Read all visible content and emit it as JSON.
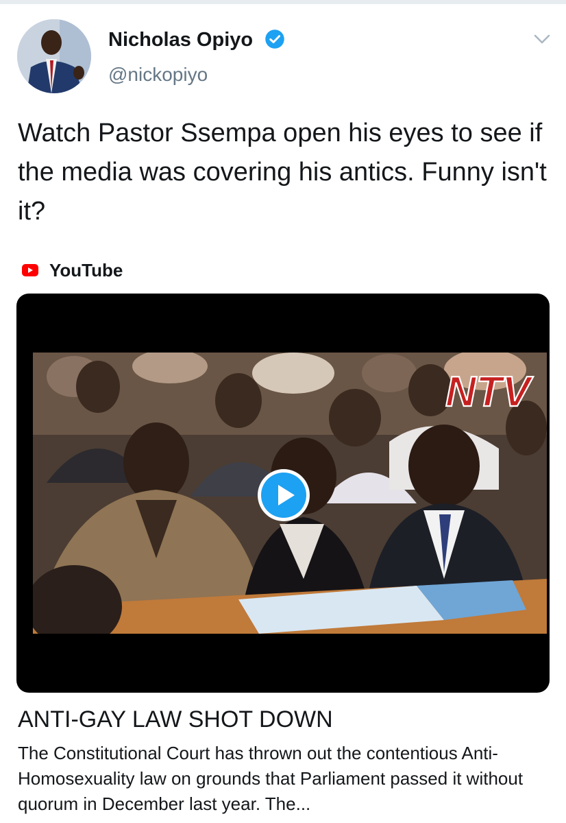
{
  "tweet": {
    "author_name": "Nicholas Opiyo",
    "verified": true,
    "handle": "@nickopiyo",
    "text": "Watch Pastor Ssempa open his eyes to see if the media was covering his antics. Funny isn't it?",
    "menu_icon": "chevron-down-icon"
  },
  "card": {
    "source_icon": "youtube-icon",
    "source_label": "YouTube",
    "video_overlay_logo": "NTV",
    "play_icon": "play-icon",
    "title": "ANTI-GAY LAW SHOT DOWN",
    "description": "The Constitutional Court has thrown out the contentious Anti-Homosexuality law on grounds that Parliament passed it without quorum in December last year. The..."
  },
  "colors": {
    "text_primary": "#14171a",
    "text_secondary": "#657786",
    "verified_blue": "#1da1f2",
    "play_blue": "#1da1f2",
    "youtube_red": "#ff0000",
    "ntv_red": "#c62020"
  }
}
